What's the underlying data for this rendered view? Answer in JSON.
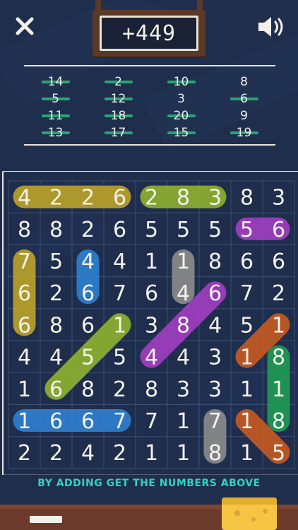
{
  "score": "+449",
  "controls": {
    "close_icon": "close-icon",
    "sound_icon": "sound-icon"
  },
  "targets": [
    "14",
    "2",
    "10",
    "8",
    "5",
    "12",
    "3",
    "6",
    "11",
    "18",
    "20",
    "9",
    "13",
    "17",
    "15",
    "19"
  ],
  "crossed_out": [
    "14",
    "2",
    "10",
    "5",
    "12",
    "6",
    "11",
    "18",
    "20",
    "13",
    "17",
    "15",
    "19"
  ],
  "grid": [
    [
      "4",
      "2",
      "2",
      "6",
      "2",
      "8",
      "3",
      "8",
      "3"
    ],
    [
      "8",
      "8",
      "2",
      "6",
      "5",
      "5",
      "5",
      "5",
      "6"
    ],
    [
      "7",
      "5",
      "4",
      "4",
      "1",
      "1",
      "8",
      "6",
      "6"
    ],
    [
      "6",
      "2",
      "6",
      "7",
      "6",
      "4",
      "6",
      "7",
      "2"
    ],
    [
      "6",
      "8",
      "6",
      "1",
      "3",
      "8",
      "4",
      "5",
      "1"
    ],
    [
      "4",
      "4",
      "5",
      "5",
      "4",
      "4",
      "3",
      "1",
      "8"
    ],
    [
      "1",
      "6",
      "8",
      "2",
      "8",
      "3",
      "3",
      "1",
      "1"
    ],
    [
      "1",
      "6",
      "6",
      "7",
      "7",
      "1",
      "7",
      "1",
      "8"
    ],
    [
      "2",
      "2",
      "4",
      "2",
      "1",
      "1",
      "8",
      "1",
      "5"
    ]
  ],
  "found_paths": [
    {
      "color": "#b8a12a",
      "from": [
        0,
        0
      ],
      "to": [
        0,
        3
      ]
    },
    {
      "color": "#8db030",
      "from": [
        0,
        4
      ],
      "to": [
        0,
        6
      ]
    },
    {
      "color": "#a03ec0",
      "from": [
        1,
        7
      ],
      "to": [
        1,
        8
      ]
    },
    {
      "color": "#b8a12a",
      "from": [
        2,
        0
      ],
      "to": [
        4,
        0
      ]
    },
    {
      "color": "#2f7fd0",
      "from": [
        2,
        2
      ],
      "to": [
        3,
        2
      ]
    },
    {
      "color": "#8a8a8a",
      "from": [
        2,
        5
      ],
      "to": [
        3,
        5
      ]
    },
    {
      "color": "#a03ec0",
      "from": [
        3,
        6
      ],
      "to": [
        5,
        4
      ]
    },
    {
      "color": "#8db030",
      "from": [
        4,
        3
      ],
      "to": [
        6,
        1
      ]
    },
    {
      "color": "#c45a22",
      "from": [
        4,
        8
      ],
      "to": [
        5,
        7
      ]
    },
    {
      "color": "#1f9a55",
      "from": [
        5,
        8
      ],
      "to": [
        7,
        8
      ]
    },
    {
      "color": "#2f7fd0",
      "from": [
        7,
        0
      ],
      "to": [
        7,
        3
      ]
    },
    {
      "color": "#8a8a8a",
      "from": [
        7,
        6
      ],
      "to": [
        8,
        6
      ]
    },
    {
      "color": "#c45a22",
      "from": [
        7,
        7
      ],
      "to": [
        8,
        8
      ]
    }
  ],
  "hint": "BY ADDING GET THE NUMBERS ABOVE",
  "colors": {
    "board_bg": "#1f2e4d",
    "chalk": "#f2f0e8",
    "hint": "#35d0c2"
  }
}
